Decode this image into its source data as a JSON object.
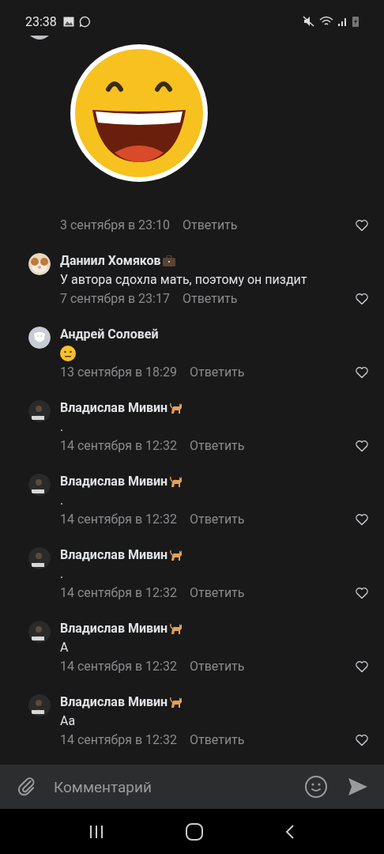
{
  "status_bar": {
    "time": "23:38"
  },
  "comments": [
    {
      "kind": "sticker",
      "sticker": {
        "kind": "grinning-face"
      },
      "date": "3 сентября в 23:10",
      "reply": "Ответить",
      "liked": false
    },
    {
      "kind": "text",
      "author": "Даниил Хомяков",
      "badge": {
        "kind": "briefcase"
      },
      "text": "У автора сдохла мать, поэтому он пиздит",
      "date": "7 сентября в 23:17",
      "reply": "Ответить",
      "liked": false
    },
    {
      "kind": "emoji",
      "author": "Андрей Соловей",
      "emoji": {
        "kind": "neutral-face"
      },
      "date": "13 сентября в 18:29",
      "reply": "Ответить",
      "liked": false
    },
    {
      "kind": "text",
      "author": "Владислав Мивин",
      "badge": {
        "kind": "cat"
      },
      "text": ".",
      "date": "14 сентября в 12:32",
      "reply": "Ответить",
      "liked": false
    },
    {
      "kind": "text",
      "author": "Владислав Мивин",
      "badge": {
        "kind": "cat"
      },
      "text": ".",
      "date": "14 сентября в 12:32",
      "reply": "Ответить",
      "liked": false
    },
    {
      "kind": "text",
      "author": "Владислав Мивин",
      "badge": {
        "kind": "cat"
      },
      "text": ".",
      "date": "14 сентября в 12:32",
      "reply": "Ответить",
      "liked": false
    },
    {
      "kind": "text",
      "author": "Владислав Мивин",
      "badge": {
        "kind": "cat"
      },
      "text": "А",
      "date": "14 сентября в 12:32",
      "reply": "Ответить",
      "liked": false
    },
    {
      "kind": "text",
      "author": "Владислав Мивин",
      "badge": {
        "kind": "cat"
      },
      "text": "Аа",
      "date": "14 сентября в 12:32",
      "reply": "Ответить",
      "liked": false
    }
  ],
  "composer": {
    "placeholder": "Комментарий"
  }
}
